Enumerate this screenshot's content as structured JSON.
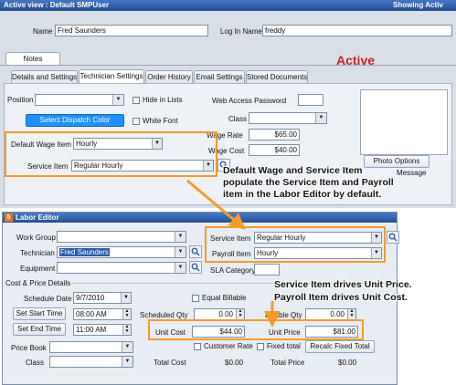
{
  "top": {
    "title": "Active view : Default SMPUser",
    "right_title": "Showing Activ",
    "name_label": "Name",
    "name_value": "Fred Saunders",
    "login_label": "Log In Name",
    "login_value": "freddy",
    "notes_tab": "Notes",
    "status": "Active",
    "tabs": [
      "Details and Settings",
      "Technician Settings",
      "Order History",
      "Email Settings",
      "Stored Documents"
    ],
    "position_label": "Position",
    "hide_in_lists": "Hide in Lists",
    "select_dispatch_color": "Select Dispatch Color",
    "white_font": "White Font",
    "web_access_password": "Web Access Password",
    "class_label": "Class",
    "wage_rate_label": "Wage Rate",
    "wage_rate_value": "$65.00",
    "wage_cost_label": "Wage Cost",
    "wage_cost_value": "$40.00",
    "default_wage_item_label": "Default Wage Item",
    "default_wage_item_value": "Hourly",
    "service_item_label": "Service Item",
    "service_item_value": "Regular Hourly",
    "photo_options": "Photo Options",
    "message_label": "Message"
  },
  "callouts": {
    "one": [
      "Default Wage and Service Item",
      "populate the Service Item and Payroll",
      "item in the Labor Editor by default."
    ],
    "two": [
      "Service Item drives Unit Price.",
      "Payroll Item drives Unit Cost."
    ]
  },
  "labor": {
    "title": "Labor Editor",
    "work_group_label": "Work Group",
    "technician_label": "Technician",
    "technician_value": "Fred Saunders",
    "equipment_label": "Equipment",
    "service_item_label": "Service Item",
    "service_item_value": "Regular Hourly",
    "payroll_item_label": "Payroll Item",
    "payroll_item_value": "Hourly",
    "sla_category_label": "SLA Category",
    "cost_price_details": "Cost & Price Details",
    "schedule_date_label": "Schedule Date",
    "schedule_date_value": "9/7/2010",
    "set_start_time": "Set Start Time",
    "start_time_value": "08:00 AM",
    "set_end_time": "Set End Time",
    "end_time_value": "11:00 AM",
    "equal_billable": "Equal Billable",
    "scheduled_qty_label": "Scheduled Qty",
    "scheduled_qty_value": "0.00",
    "billable_qty_label": "Billable Qty",
    "billable_qty_value": "0.00",
    "unit_cost_label": "Unit Cost",
    "unit_cost_value": "$44.00",
    "unit_price_label": "Unit Price",
    "unit_price_value": "$81.00",
    "price_book_label": "Price Book",
    "class_label": "Class",
    "customer_rate": "Customer Rate",
    "fixed_total": "Fixed total",
    "recalc_fixed_total": "Recalc Fixed Total",
    "total_cost_label": "Total Cost",
    "total_cost_value": "$0.00",
    "total_price_label": "Total Price",
    "total_price_value": "$0.00"
  },
  "colors": {
    "accent_orange": "#f39a2b",
    "status_red": "#cc2222",
    "dispatch_blue": "#1e90ff",
    "title_bar": "#2a5aa8"
  }
}
